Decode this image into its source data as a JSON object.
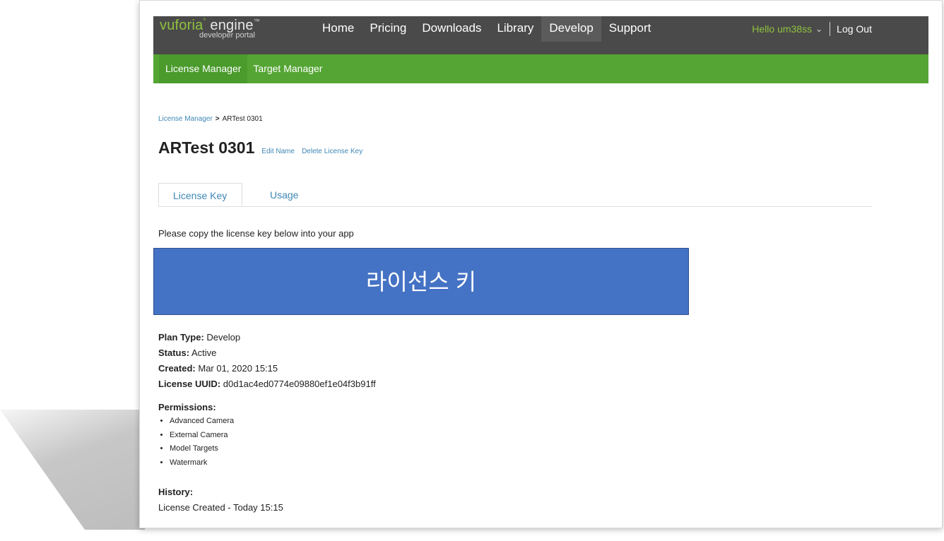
{
  "logo": {
    "brand": "vuforia",
    "product": "engine",
    "subtitle": "developer portal"
  },
  "nav": {
    "items": [
      {
        "label": "Home"
      },
      {
        "label": "Pricing"
      },
      {
        "label": "Downloads"
      },
      {
        "label": "Library"
      },
      {
        "label": "Develop",
        "active": true
      },
      {
        "label": "Support"
      }
    ],
    "greeting": "Hello um38ss",
    "logout": "Log Out"
  },
  "subnav": {
    "items": [
      {
        "label": "License Manager",
        "active": true
      },
      {
        "label": "Target Manager"
      }
    ]
  },
  "breadcrumb": {
    "parent": "License Manager",
    "current": "ARTest 0301"
  },
  "title": "ARTest 0301",
  "title_actions": {
    "edit": "Edit Name",
    "delete": "Delete License Key"
  },
  "tabs": [
    {
      "label": "License Key",
      "active": true
    },
    {
      "label": "Usage"
    }
  ],
  "instruction": "Please copy the license key below into your app",
  "license_key_overlay": "라이선스 키",
  "details": {
    "plan_type_label": "Plan Type:",
    "plan_type": "Develop",
    "status_label": "Status:",
    "status": "Active",
    "created_label": "Created:",
    "created": "Mar 01, 2020 15:15",
    "uuid_label": "License UUID:",
    "uuid": "d0d1ac4ed0774e09880ef1e04f3b91ff"
  },
  "permissions": {
    "label": "Permissions:",
    "items": [
      "Advanced Camera",
      "External Camera",
      "Model Targets",
      "Watermark"
    ]
  },
  "history": {
    "label": "History:",
    "entries": [
      "License Created - Today 15:15"
    ]
  },
  "colors": {
    "nav_bg": "#4a4a4a",
    "subnav_bg": "#55a534",
    "link": "#3f87b5",
    "key_box": "#4472c4",
    "greeting": "#8fc23e"
  }
}
